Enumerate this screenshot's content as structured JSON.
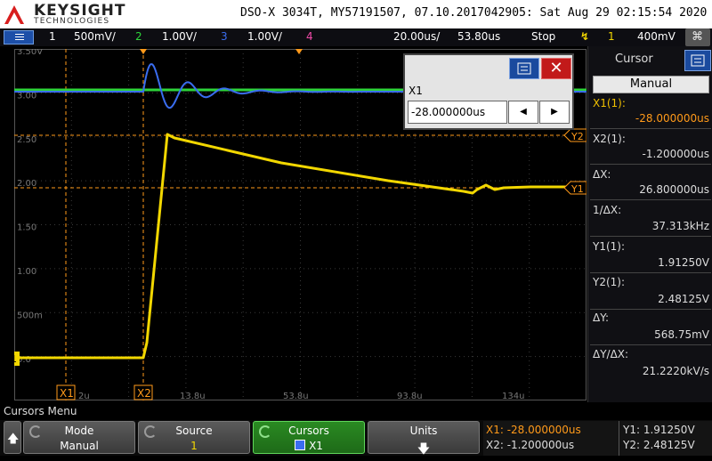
{
  "header": {
    "brand": "KEYSIGHT",
    "brand_sub": "TECHNOLOGIES",
    "title": "DSO-X 3034T, MY57191507, 07.10.2017042905: Sat Aug 29 02:15:54 2020"
  },
  "status_bar": {
    "ch1_num": "1",
    "ch1_scale": "500mV/",
    "ch2_num": "2",
    "ch2_scale": "1.00V/",
    "ch3_num": "3",
    "ch3_scale": "1.00V/",
    "ch4_num": "4",
    "timebase": "20.00us/",
    "delay": "53.80us",
    "run_state": "Stop",
    "trigger_icon": "trigger-edge-icon",
    "trig_source": "1",
    "trig_level": "400mV",
    "colors": {
      "ch1": "#f2d700",
      "ch2": "#2dd43a",
      "ch3": "#3a6df0",
      "ch4": "#f04aa8"
    }
  },
  "graticule": {
    "y_labels": [
      "3.50V",
      "3.00",
      "2.50",
      "2.00",
      "1.50",
      "1.00",
      "500m",
      "0.0"
    ],
    "x_labels": [
      "2u",
      "13.8u",
      "53.8u",
      "93.8u",
      "134u"
    ],
    "markers": {
      "x1": "X1",
      "x2": "X2",
      "y1": "Y1",
      "y2": "Y2",
      "ground": "1",
      "trigger": "T"
    }
  },
  "popup": {
    "label": "X1",
    "value": "-28.000000us",
    "left_icon": "arrow-left-icon",
    "right_icon": "arrow-right-icon",
    "close_icon": "close-icon",
    "menu_icon": "menu-icon"
  },
  "cursor_panel": {
    "title": "Cursor",
    "mode": "Manual",
    "rows": [
      {
        "label": "X1(1):",
        "value": "-28.000000us"
      },
      {
        "label": "X2(1):",
        "value": "-1.200000us"
      },
      {
        "label": "ΔX:",
        "value": "26.800000us"
      },
      {
        "label": "1/ΔX:",
        "value": "37.313kHz"
      },
      {
        "label": "Y1(1):",
        "value": "1.91250V"
      },
      {
        "label": "Y2(1):",
        "value": "2.48125V"
      },
      {
        "label": "ΔY:",
        "value": "568.75mV"
      },
      {
        "label": "ΔY/ΔX:",
        "value": "21.2220kV/s"
      }
    ]
  },
  "softkeys": {
    "menu_title": "Cursors Menu",
    "mode_label": "Mode",
    "mode_value": "Manual",
    "source_label": "Source",
    "source_value": "1",
    "cursors_label": "Cursors",
    "cursors_value": "X1",
    "units_label": "Units"
  },
  "readout": {
    "x1": "X1: -28.000000us",
    "x2": "X2: -1.200000us",
    "y1": "Y1: 1.91250V",
    "y2": "Y2: 2.48125V"
  }
}
